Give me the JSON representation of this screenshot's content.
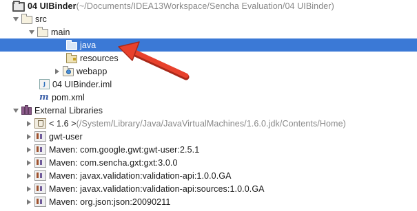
{
  "project": {
    "name": "04 UIBinder",
    "path": " (~/Documents/IDEA13Workspace/Sencha Evaluation/04 UIBinder)"
  },
  "nodes": {
    "src": "src",
    "main": "main",
    "java": "java",
    "resources": "resources",
    "webapp": "webapp",
    "iml": "04 UIBinder.iml",
    "pom": "pom.xml",
    "external_libraries": "External Libraries",
    "jdk_name": "< 1.6 >",
    "jdk_path": " (/System/Library/Java/JavaVirtualMachines/1.6.0.jdk/Contents/Home)",
    "gwt_user": "gwt-user",
    "maven_gwt": "Maven: com.google.gwt:gwt-user:2.5.1",
    "maven_gxt": "Maven: com.sencha.gxt:gxt:3.0.0",
    "maven_validation": "Maven: javax.validation:validation-api:1.0.0.GA",
    "maven_validation_sources": "Maven: javax.validation:validation-api:sources:1.0.0.GA",
    "maven_json": "Maven: org.json:json:20090211"
  },
  "icons": {
    "iml_glyph": "J",
    "maven_glyph": "m"
  },
  "colors": {
    "selection": "#3b79d6",
    "annotation_arrow": "#e8412c"
  }
}
